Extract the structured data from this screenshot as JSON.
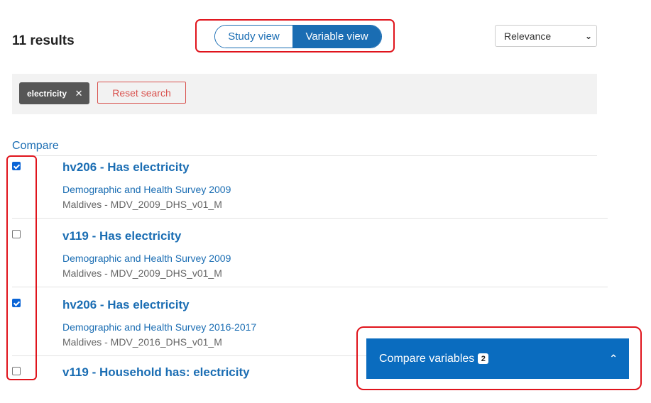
{
  "results": {
    "count_label": "11 results"
  },
  "view_toggle": {
    "study_label": "Study view",
    "variable_label": "Variable view",
    "active": "variable"
  },
  "sort": {
    "selected": "Relevance"
  },
  "filters": {
    "tag_label": "electricity",
    "reset_label": "Reset search"
  },
  "compare_header": "Compare",
  "items": [
    {
      "title": "hv206 - Has electricity",
      "study": "Demographic and Health Survey 2009",
      "meta": "Maldives - MDV_2009_DHS_v01_M",
      "checked": true
    },
    {
      "title": "v119 - Has electricity",
      "study": "Demographic and Health Survey 2009",
      "meta": "Maldives - MDV_2009_DHS_v01_M",
      "checked": false
    },
    {
      "title": "hv206 - Has electricity",
      "study": "Demographic and Health Survey 2016-2017",
      "meta": "Maldives - MDV_2016_DHS_v01_M",
      "checked": true
    },
    {
      "title": "v119 - Household has: electricity",
      "study": "",
      "meta": "",
      "checked": false
    }
  ],
  "compare_panel": {
    "label": "Compare variables",
    "count": "2"
  },
  "colors": {
    "accent": "#1a6db3",
    "panel": "#0a6cbf",
    "highlight": "#e0141c",
    "danger": "#d9534f"
  },
  "icons": {
    "tag_close": "close-icon",
    "sort": "chevron-down-icon",
    "panel": "chevron-up-icon"
  }
}
